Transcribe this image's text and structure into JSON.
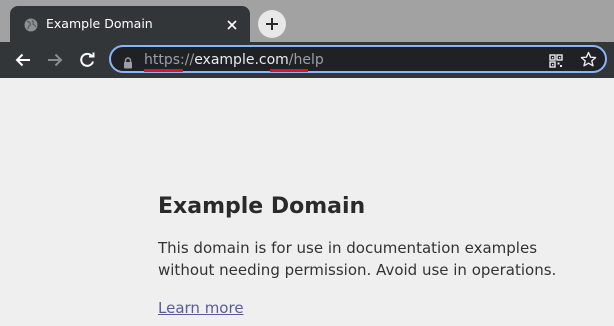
{
  "browser": {
    "tab_title": "Example Domain",
    "address": {
      "scheme": "https://",
      "host": "example.com",
      "path": "/help"
    }
  },
  "page": {
    "heading": "Example Domain",
    "paragraph": "This domain is for use in documentation examples without needing permission. Avoid use in operations.",
    "link_text": "Learn more"
  },
  "colors": {
    "tabstrip": "#a2a2a2",
    "toolbar": "#323639",
    "focus_ring": "#8ab4f8",
    "annotation_underline": "#d61a1a",
    "page_background": "#efefef",
    "link": "#5a5aa0"
  }
}
